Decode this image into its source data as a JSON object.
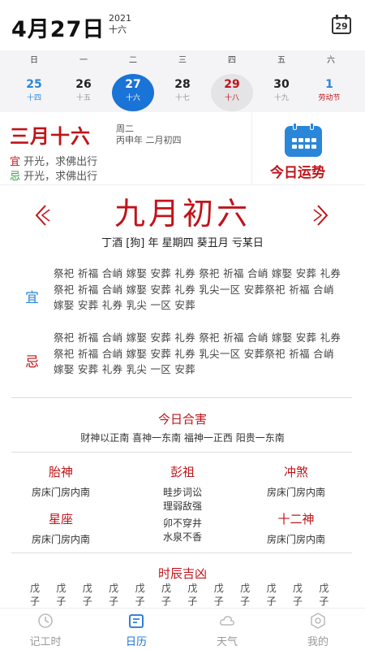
{
  "header": {
    "date_title": "4月27日",
    "year": "2021",
    "lunar_day": "十六",
    "calendar_button_day": "29"
  },
  "week_headers": [
    "日",
    "一",
    "二",
    "三",
    "四",
    "五",
    "六"
  ],
  "week_days": [
    {
      "num": "25",
      "lunar": "十四",
      "style": "blue"
    },
    {
      "num": "26",
      "lunar": "十五",
      "style": "normal"
    },
    {
      "num": "27",
      "lunar": "十六",
      "style": "selected"
    },
    {
      "num": "28",
      "lunar": "十七",
      "style": "normal"
    },
    {
      "num": "29",
      "lunar": "十八",
      "style": "today"
    },
    {
      "num": "30",
      "lunar": "十九",
      "style": "normal"
    },
    {
      "num": "1",
      "lunar": "劳动节",
      "style": "holiday"
    }
  ],
  "fortune": {
    "lunar_date": "三月十六",
    "weekday": "周二",
    "ganzhi": "丙申年 二月初四",
    "yi_mark": "宜",
    "yi_text": " 开光，求佛出行",
    "ji_mark": "忌",
    "ji_text": " 开光，求佛出行",
    "today_luck_label": "今日运势"
  },
  "main": {
    "lunar_date": "九月初六",
    "ganzhi_line": "丁酒 [狗] 年  星期四  葵丑月  亏某日"
  },
  "yi": {
    "label": "宜",
    "text": "祭祀 祈福 合峭 嫁娶 安葬 礼券 祭祀 祈福 合峭 嫁娶 安葬 礼券 祭祀 祈福 合峭 嫁娶 安葬 礼券 乳尖一区 安葬祭祀 祈福 合峭 嫁娶 安葬 礼券 乳尖 一区 安葬"
  },
  "ji": {
    "label": "忌",
    "text": "祭祀 祈福 合峭 嫁娶 安葬 礼券 祭祀 祈福 合峭 嫁娶 安葬 礼券 祭祀 祈福 合峭 嫁娶 安葬 礼券 乳尖一区 安葬祭祀 祈福 合峭 嫁娶 安葬 礼券 乳尖 一区 安葬"
  },
  "hehai": {
    "title": "今日合害",
    "text": "财神以正南  喜神一东南  福神一正西  阳贵一东南"
  },
  "grid": {
    "taishen": {
      "title": "胎神",
      "value": "房床门房内南"
    },
    "pengzu": {
      "title": "彭祖",
      "line1": "畦步词讼",
      "line2": "理弱敌强",
      "line3": "卯不穿井",
      "line4": "水泉不香"
    },
    "chongsha": {
      "title": "冲煞",
      "value": "房床门房内南"
    },
    "xingzuo": {
      "title": "星座",
      "value": "房床门房内南"
    },
    "shiershen": {
      "title": "十二神",
      "value": "房床门房内南"
    }
  },
  "shichen": {
    "title": "时辰吉凶",
    "cols": [
      {
        "top": "戊",
        "bottom": "子"
      },
      {
        "top": "戊",
        "bottom": "子"
      },
      {
        "top": "戊",
        "bottom": "子"
      },
      {
        "top": "戊",
        "bottom": "子"
      },
      {
        "top": "戊",
        "bottom": "子"
      },
      {
        "top": "戊",
        "bottom": "子"
      },
      {
        "top": "戊",
        "bottom": "子"
      },
      {
        "top": "戊",
        "bottom": "子"
      },
      {
        "top": "戊",
        "bottom": "子"
      },
      {
        "top": "戊",
        "bottom": "子"
      },
      {
        "top": "戊",
        "bottom": "子"
      },
      {
        "top": "戊",
        "bottom": "子"
      }
    ]
  },
  "tabs": [
    {
      "label": "记工时",
      "icon": "clock-icon",
      "active": false
    },
    {
      "label": "日历",
      "icon": "calendar-icon",
      "active": true
    },
    {
      "label": "天气",
      "icon": "cloud-icon",
      "active": false
    },
    {
      "label": "我的",
      "icon": "user-icon",
      "active": false
    }
  ],
  "colors": {
    "accent_blue": "#1a73d6",
    "accent_red": "#c0141a",
    "yi_green": "#2b9a3a"
  }
}
